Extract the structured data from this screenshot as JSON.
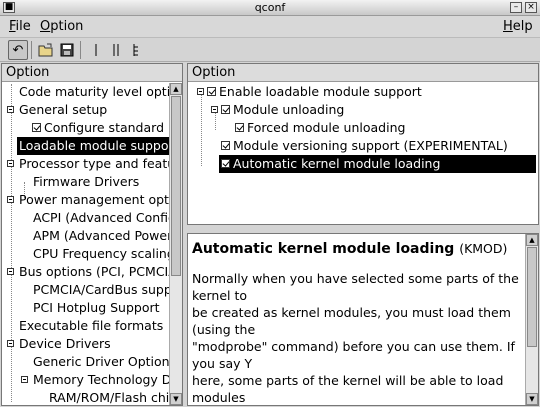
{
  "window": {
    "title": "qconf",
    "minimize_icon": "minimize-icon",
    "close_icon": "close-icon"
  },
  "menubar": {
    "file": {
      "key": "F",
      "rest": "ile"
    },
    "option": {
      "key": "O",
      "rest": "ption"
    },
    "help": {
      "key": "H",
      "rest": "elp"
    }
  },
  "toolbar": {
    "buttons": [
      "back-icon",
      "open-icon",
      "save-icon",
      "single-view-icon",
      "split-view-icon",
      "full-view-icon"
    ]
  },
  "left_pane": {
    "header": "Option",
    "rows": [
      "Code maturity level optic",
      "General setup",
      "Configure standard k",
      "Loadable module support",
      "Processor type and featu",
      "Firmware Drivers",
      "Power management opti",
      "ACPI (Advanced Config",
      "APM (Advanced Power",
      "CPU Frequency scaling",
      "Bus options (PCI, PCMCIA",
      "PCMCIA/CardBus supp",
      "PCI Hotplug Support",
      "Executable file formats",
      "Device Drivers",
      "Generic Driver Options",
      "Memory Technology D",
      "RAM/ROM/Flash chi"
    ]
  },
  "right_pane": {
    "header": "Option",
    "rows": [
      "Enable loadable module support",
      "Module unloading",
      "Forced module unloading",
      "Module versioning support (EXPERIMENTAL)",
      "Automatic kernel module loading"
    ]
  },
  "help_pane": {
    "title": "Automatic kernel module loading",
    "symbol": "(KMOD)",
    "lines": [
      "Normally when you have selected some parts of the",
      "kernel to",
      "be created as kernel modules, you must load them",
      "(using the",
      "\"modprobe\" command) before you can use them. If",
      "you say Y",
      "here, some parts of the kernel will be able to load",
      "modules"
    ]
  }
}
